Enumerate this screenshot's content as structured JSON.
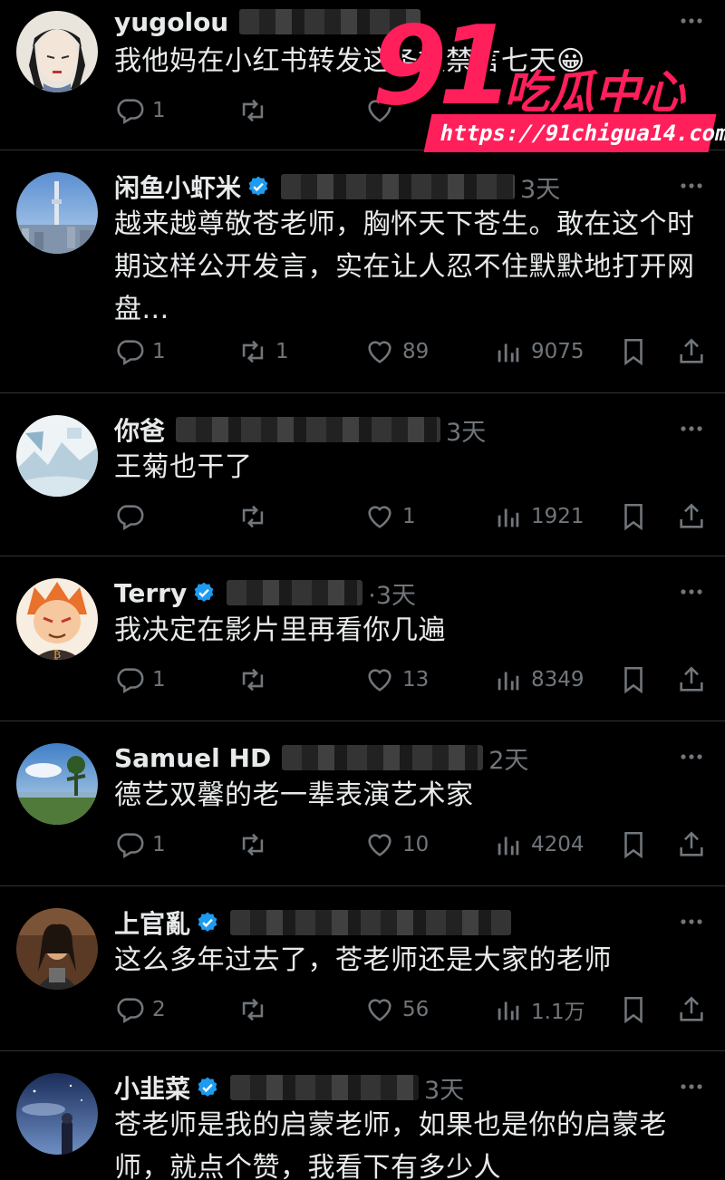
{
  "tweets": [
    {
      "name": "yugolou",
      "time": "",
      "text": "我他妈在小红书转发这条被禁言七天😀",
      "reply": "1",
      "retweet": "",
      "like": "",
      "views": ""
    },
    {
      "name": "闲鱼小虾米",
      "time": "3天",
      "text": "越来越尊敬苍老师，胸怀天下苍生。敢在这个时期这样公开发言，实在让人忍不住默默地打开网盘...",
      "reply": "1",
      "retweet": "1",
      "like": "89",
      "views": "9075"
    },
    {
      "name": "你爸",
      "time": "3天",
      "text": "王菊也干了",
      "reply": "",
      "retweet": "",
      "like": "1",
      "views": "1921"
    },
    {
      "name": "Terry",
      "time": "·3天",
      "text": "我决定在影片里再看你几遍",
      "reply": "1",
      "retweet": "",
      "like": "13",
      "views": "8349"
    },
    {
      "name": "Samuel HD",
      "time": "2天",
      "text": "德艺双馨的老一辈表演艺术家",
      "reply": "1",
      "retweet": "",
      "like": "10",
      "views": "4204"
    },
    {
      "name": "上官亂",
      "time": "",
      "text": "这么多年过去了，苍老师还是大家的老师",
      "reply": "2",
      "retweet": "",
      "like": "56",
      "views": "1.1万"
    },
    {
      "name": "小韭菜",
      "time": "3天",
      "text": "苍老师是我的启蒙老师，如果也是你的启蒙老师，就点个赞，我看下有多少人",
      "reply": "",
      "retweet": "",
      "like": "",
      "views": ""
    }
  ],
  "watermark": {
    "number": "91",
    "brand": "吃瓜中心",
    "url": "https://91chigua14.com"
  },
  "colors": {
    "background": "#000000",
    "text": "#e7e9ea",
    "muted": "#71767b",
    "verified": "#1d9bf0",
    "divider": "#2f3336",
    "watermark": "#ff1f5a"
  }
}
